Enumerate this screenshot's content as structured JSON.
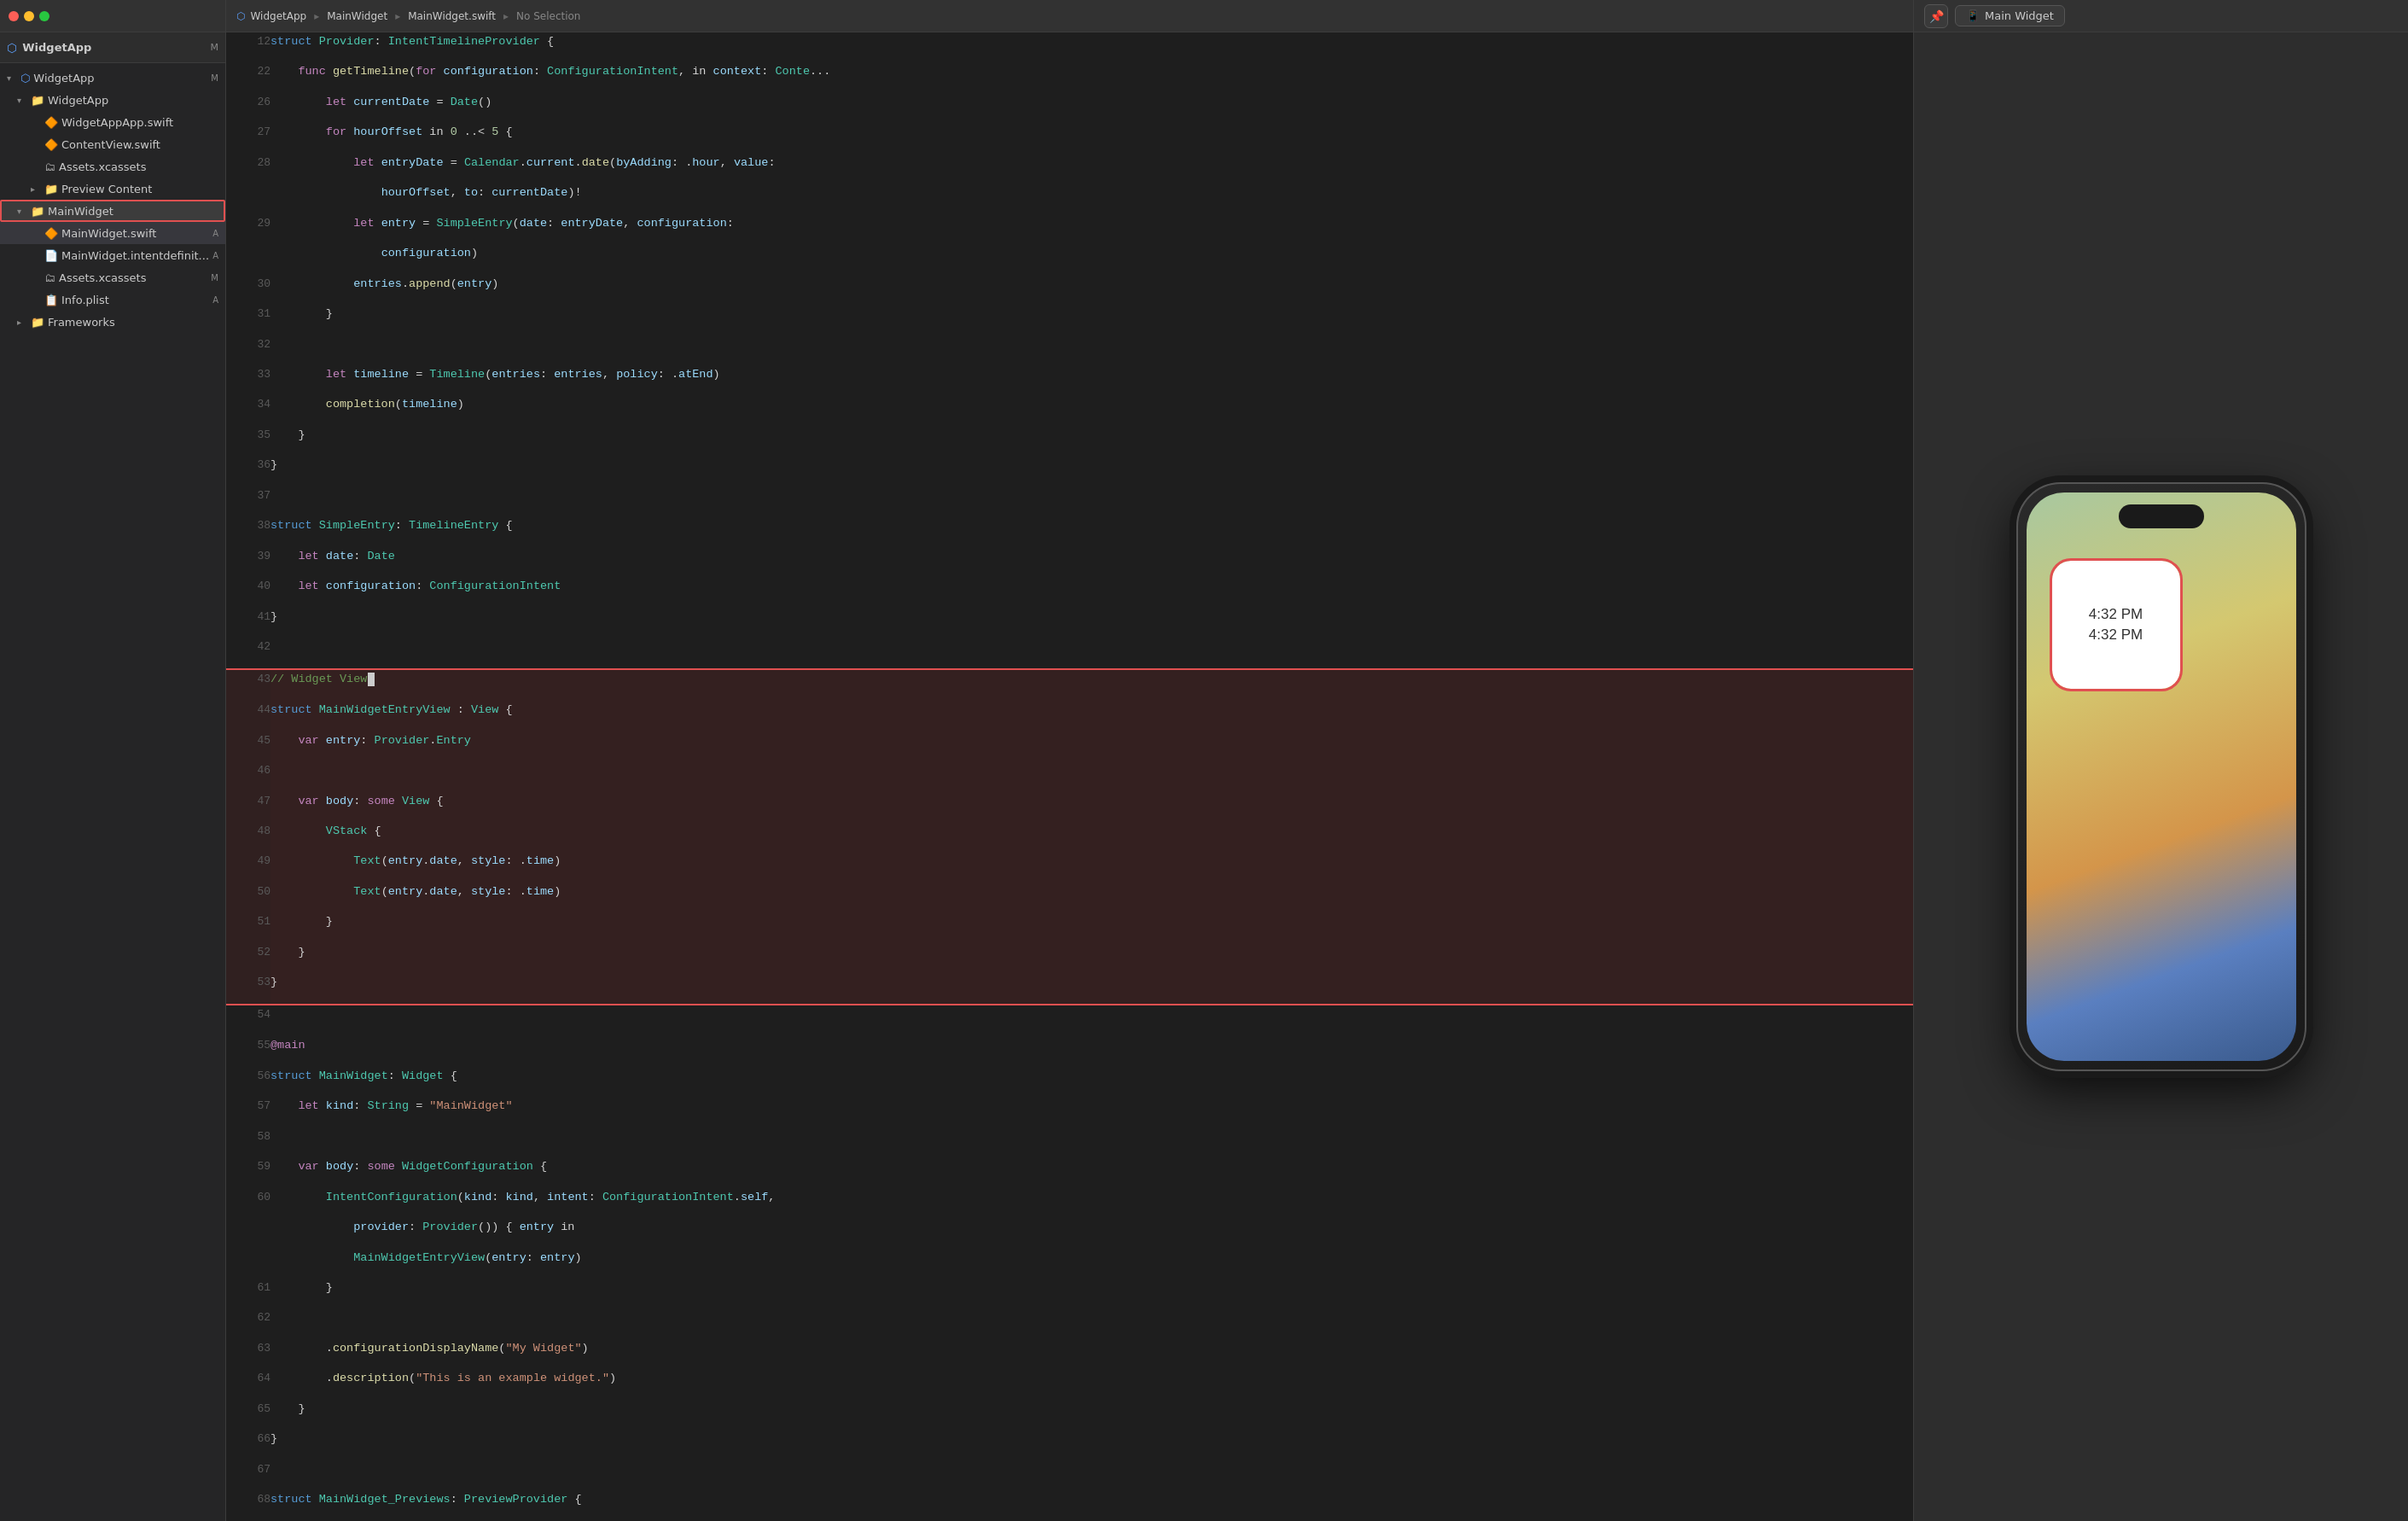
{
  "app": {
    "title": "WidgetApp",
    "top_bar": "WidgetApp  ▸  MainWidget  ▸  MainWidget.swift  ▸  No Selection"
  },
  "sidebar": {
    "items": [
      {
        "id": "widgetapp-root",
        "label": "WidgetApp",
        "indent": 0,
        "type": "folder",
        "expanded": true,
        "badge": "M"
      },
      {
        "id": "widgetapp-group",
        "label": "WidgetApp",
        "indent": 1,
        "type": "folder",
        "expanded": true
      },
      {
        "id": "widgetappapp-swift",
        "label": "WidgetAppApp.swift",
        "indent": 2,
        "type": "swift"
      },
      {
        "id": "contentview-swift",
        "label": "ContentView.swift",
        "indent": 2,
        "type": "swift"
      },
      {
        "id": "assets-xcassets",
        "label": "Assets.xcassets",
        "indent": 2,
        "type": "xcassets"
      },
      {
        "id": "preview-content",
        "label": "Preview Content",
        "indent": 2,
        "type": "folder"
      },
      {
        "id": "mainwidget-group",
        "label": "MainWidget",
        "indent": 1,
        "type": "folder",
        "expanded": true,
        "highlighted": true
      },
      {
        "id": "mainwidget-swift",
        "label": "MainWidget.swift",
        "indent": 2,
        "type": "swift",
        "selected": true,
        "badge": "A"
      },
      {
        "id": "mainwidget-intentdef",
        "label": "MainWidget.intentdefinit...",
        "indent": 2,
        "type": "intent",
        "badge": "A"
      },
      {
        "id": "assets2-xcassets",
        "label": "Assets.xcassets",
        "indent": 2,
        "type": "xcassets",
        "badge": "M"
      },
      {
        "id": "info-plist",
        "label": "Info.plist",
        "indent": 2,
        "type": "plist",
        "badge": "A"
      },
      {
        "id": "frameworks",
        "label": "Frameworks",
        "indent": 1,
        "type": "folder"
      }
    ]
  },
  "editor": {
    "breadcrumb": "WidgetApp  ▸  MainWidget  ▸  MainWidget.swift  ▸  No Selection",
    "tab": "MainWidget.swift",
    "lines": [
      {
        "n": 12,
        "code": "struct Provider: IntentTimelineProvider {"
      },
      {
        "n": 22,
        "code": "    func getTimeline(for configuration: ConfigurationIntent, in context: Conte..."
      },
      {
        "n": 26,
        "code": "        let currentDate = Date()"
      },
      {
        "n": 27,
        "code": "        for hourOffset in 0 ..< 5 {"
      },
      {
        "n": 28,
        "code": "            let entryDate = Calendar.current.date(byAdding: .hour, value:"
      },
      {
        "n": "",
        "code": "                hourOffset, to: currentDate)!"
      },
      {
        "n": 29,
        "code": "            let entry = SimpleEntry(date: entryDate, configuration:"
      },
      {
        "n": "",
        "code": "                configuration)"
      },
      {
        "n": 30,
        "code": "            entries.append(entry)"
      },
      {
        "n": 31,
        "code": "        }"
      },
      {
        "n": 32,
        "code": ""
      },
      {
        "n": 33,
        "code": "        let timeline = Timeline(entries: entries, policy: .atEnd)"
      },
      {
        "n": 34,
        "code": "        completion(timeline)"
      },
      {
        "n": 35,
        "code": "    }"
      },
      {
        "n": 36,
        "code": "}"
      },
      {
        "n": 37,
        "code": ""
      },
      {
        "n": 38,
        "code": "struct SimpleEntry: TimelineEntry {"
      },
      {
        "n": 39,
        "code": "    let date: Date"
      },
      {
        "n": 40,
        "code": "    let configuration: ConfigurationIntent"
      },
      {
        "n": 41,
        "code": "}"
      },
      {
        "n": 42,
        "code": ""
      },
      {
        "n": 43,
        "code": "// Widget View",
        "highlight": true
      },
      {
        "n": 44,
        "code": "struct MainWidgetEntryView : View {",
        "highlight": true
      },
      {
        "n": 45,
        "code": "    var entry: Provider.Entry",
        "highlight": true
      },
      {
        "n": 46,
        "code": "",
        "highlight": true
      },
      {
        "n": 47,
        "code": "    var body: some View {",
        "highlight": true
      },
      {
        "n": 48,
        "code": "        VStack {",
        "highlight": true
      },
      {
        "n": 49,
        "code": "            Text(entry.date, style: .time)",
        "highlight": true
      },
      {
        "n": 50,
        "code": "            Text(entry.date, style: .time)",
        "highlight": true
      },
      {
        "n": 51,
        "code": "        }",
        "highlight": true
      },
      {
        "n": 52,
        "code": "    }",
        "highlight": true
      },
      {
        "n": 53,
        "code": "}",
        "highlight": true
      },
      {
        "n": 54,
        "code": ""
      },
      {
        "n": 55,
        "code": "@main"
      },
      {
        "n": 56,
        "code": "struct MainWidget: Widget {"
      },
      {
        "n": 57,
        "code": "    let kind: String = \"MainWidget\""
      },
      {
        "n": 58,
        "code": ""
      },
      {
        "n": 59,
        "code": "    var body: some WidgetConfiguration {"
      },
      {
        "n": 60,
        "code": "        IntentConfiguration(kind: kind, intent: ConfigurationIntent.self,"
      },
      {
        "n": "",
        "code": "            provider: Provider()) { entry in"
      },
      {
        "n": "",
        "code": "            MainWidgetEntryView(entry: entry)"
      },
      {
        "n": 61,
        "code": "        }"
      },
      {
        "n": 62,
        "code": ""
      },
      {
        "n": 63,
        "code": "        .configurationDisplayName(\"My Widget\")"
      },
      {
        "n": 64,
        "code": "        .description(\"This is an example widget.\")"
      },
      {
        "n": 65,
        "code": "    }"
      },
      {
        "n": 66,
        "code": "}"
      },
      {
        "n": 67,
        "code": ""
      },
      {
        "n": 68,
        "code": "struct MainWidget_Previews: PreviewProvider {"
      }
    ]
  },
  "preview": {
    "title": "Main Widget",
    "widget_time1": "4:32 PM",
    "widget_time2": "4:32 PM",
    "phone_icon": "📱"
  }
}
